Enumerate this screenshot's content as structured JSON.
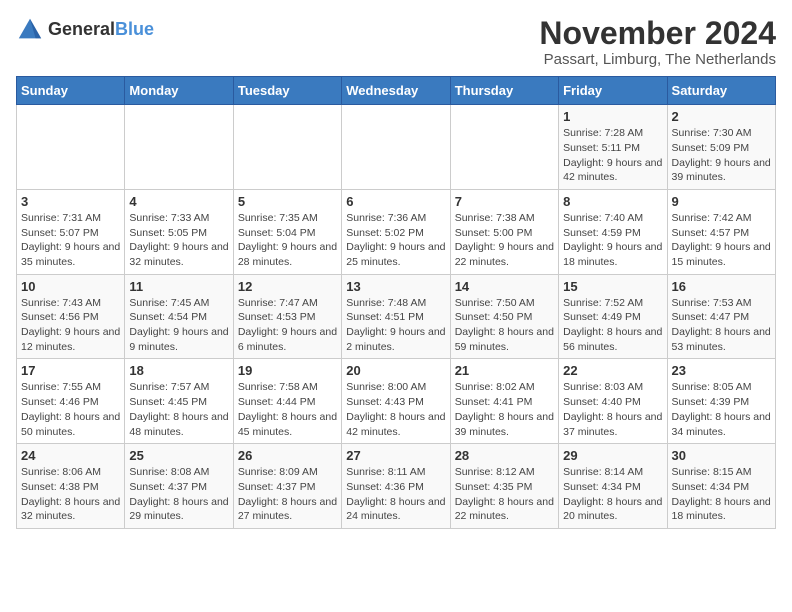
{
  "header": {
    "logo_general": "General",
    "logo_blue": "Blue",
    "month_year": "November 2024",
    "location": "Passart, Limburg, The Netherlands"
  },
  "days_of_week": [
    "Sunday",
    "Monday",
    "Tuesday",
    "Wednesday",
    "Thursday",
    "Friday",
    "Saturday"
  ],
  "weeks": [
    [
      {
        "day": "",
        "info": ""
      },
      {
        "day": "",
        "info": ""
      },
      {
        "day": "",
        "info": ""
      },
      {
        "day": "",
        "info": ""
      },
      {
        "day": "",
        "info": ""
      },
      {
        "day": "1",
        "info": "Sunrise: 7:28 AM\nSunset: 5:11 PM\nDaylight: 9 hours and 42 minutes."
      },
      {
        "day": "2",
        "info": "Sunrise: 7:30 AM\nSunset: 5:09 PM\nDaylight: 9 hours and 39 minutes."
      }
    ],
    [
      {
        "day": "3",
        "info": "Sunrise: 7:31 AM\nSunset: 5:07 PM\nDaylight: 9 hours and 35 minutes."
      },
      {
        "day": "4",
        "info": "Sunrise: 7:33 AM\nSunset: 5:05 PM\nDaylight: 9 hours and 32 minutes."
      },
      {
        "day": "5",
        "info": "Sunrise: 7:35 AM\nSunset: 5:04 PM\nDaylight: 9 hours and 28 minutes."
      },
      {
        "day": "6",
        "info": "Sunrise: 7:36 AM\nSunset: 5:02 PM\nDaylight: 9 hours and 25 minutes."
      },
      {
        "day": "7",
        "info": "Sunrise: 7:38 AM\nSunset: 5:00 PM\nDaylight: 9 hours and 22 minutes."
      },
      {
        "day": "8",
        "info": "Sunrise: 7:40 AM\nSunset: 4:59 PM\nDaylight: 9 hours and 18 minutes."
      },
      {
        "day": "9",
        "info": "Sunrise: 7:42 AM\nSunset: 4:57 PM\nDaylight: 9 hours and 15 minutes."
      }
    ],
    [
      {
        "day": "10",
        "info": "Sunrise: 7:43 AM\nSunset: 4:56 PM\nDaylight: 9 hours and 12 minutes."
      },
      {
        "day": "11",
        "info": "Sunrise: 7:45 AM\nSunset: 4:54 PM\nDaylight: 9 hours and 9 minutes."
      },
      {
        "day": "12",
        "info": "Sunrise: 7:47 AM\nSunset: 4:53 PM\nDaylight: 9 hours and 6 minutes."
      },
      {
        "day": "13",
        "info": "Sunrise: 7:48 AM\nSunset: 4:51 PM\nDaylight: 9 hours and 2 minutes."
      },
      {
        "day": "14",
        "info": "Sunrise: 7:50 AM\nSunset: 4:50 PM\nDaylight: 8 hours and 59 minutes."
      },
      {
        "day": "15",
        "info": "Sunrise: 7:52 AM\nSunset: 4:49 PM\nDaylight: 8 hours and 56 minutes."
      },
      {
        "day": "16",
        "info": "Sunrise: 7:53 AM\nSunset: 4:47 PM\nDaylight: 8 hours and 53 minutes."
      }
    ],
    [
      {
        "day": "17",
        "info": "Sunrise: 7:55 AM\nSunset: 4:46 PM\nDaylight: 8 hours and 50 minutes."
      },
      {
        "day": "18",
        "info": "Sunrise: 7:57 AM\nSunset: 4:45 PM\nDaylight: 8 hours and 48 minutes."
      },
      {
        "day": "19",
        "info": "Sunrise: 7:58 AM\nSunset: 4:44 PM\nDaylight: 8 hours and 45 minutes."
      },
      {
        "day": "20",
        "info": "Sunrise: 8:00 AM\nSunset: 4:43 PM\nDaylight: 8 hours and 42 minutes."
      },
      {
        "day": "21",
        "info": "Sunrise: 8:02 AM\nSunset: 4:41 PM\nDaylight: 8 hours and 39 minutes."
      },
      {
        "day": "22",
        "info": "Sunrise: 8:03 AM\nSunset: 4:40 PM\nDaylight: 8 hours and 37 minutes."
      },
      {
        "day": "23",
        "info": "Sunrise: 8:05 AM\nSunset: 4:39 PM\nDaylight: 8 hours and 34 minutes."
      }
    ],
    [
      {
        "day": "24",
        "info": "Sunrise: 8:06 AM\nSunset: 4:38 PM\nDaylight: 8 hours and 32 minutes."
      },
      {
        "day": "25",
        "info": "Sunrise: 8:08 AM\nSunset: 4:37 PM\nDaylight: 8 hours and 29 minutes."
      },
      {
        "day": "26",
        "info": "Sunrise: 8:09 AM\nSunset: 4:37 PM\nDaylight: 8 hours and 27 minutes."
      },
      {
        "day": "27",
        "info": "Sunrise: 8:11 AM\nSunset: 4:36 PM\nDaylight: 8 hours and 24 minutes."
      },
      {
        "day": "28",
        "info": "Sunrise: 8:12 AM\nSunset: 4:35 PM\nDaylight: 8 hours and 22 minutes."
      },
      {
        "day": "29",
        "info": "Sunrise: 8:14 AM\nSunset: 4:34 PM\nDaylight: 8 hours and 20 minutes."
      },
      {
        "day": "30",
        "info": "Sunrise: 8:15 AM\nSunset: 4:34 PM\nDaylight: 8 hours and 18 minutes."
      }
    ]
  ]
}
